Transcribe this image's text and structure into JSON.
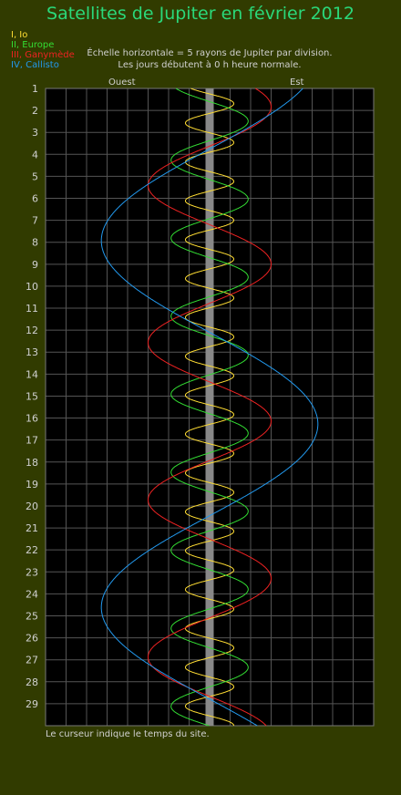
{
  "title": "Satellites de Jupiter en février 2012",
  "legend": [
    {
      "label": "I, Io",
      "color": "#ffdd33"
    },
    {
      "label": "II, Europe",
      "color": "#33dd33"
    },
    {
      "label": "III, Ganymède",
      "color": "#ee2222"
    },
    {
      "label": "IV, Callisto",
      "color": "#2299ee"
    }
  ],
  "note_line1": "Échelle horizontale = 5 rayons de Jupiter par division.",
  "note_line2": "Les jours débutent à 0 h heure normale.",
  "west_label": "Ouest",
  "east_label": "Est",
  "footer": "Le curseur indique le temps du site.",
  "chart_data": {
    "type": "line",
    "title": "Satellites de Jupiter en février 2012",
    "x_unit": "Jupiter radii (5 per division)",
    "xlim": [
      -40,
      40
    ],
    "ylim": [
      1,
      30
    ],
    "y_ticks": [
      1,
      2,
      3,
      4,
      5,
      6,
      7,
      8,
      9,
      10,
      11,
      12,
      13,
      14,
      15,
      16,
      17,
      18,
      19,
      20,
      21,
      22,
      23,
      24,
      25,
      26,
      27,
      28,
      29
    ],
    "series": [
      {
        "name": "I, Io",
        "color": "#ffdd33",
        "amplitude": 5.9,
        "period_days": 1.769,
        "phase_day": 1.25
      },
      {
        "name": "II, Europe",
        "color": "#33dd33",
        "amplitude": 9.4,
        "period_days": 3.551,
        "phase_day": 1.6
      },
      {
        "name": "III, Ganymède",
        "color": "#ee2222",
        "amplitude": 15.0,
        "period_days": 7.155,
        "phase_day": 7.2
      },
      {
        "name": "IV, Callisto",
        "color": "#2299ee",
        "amplitude": 26.4,
        "period_days": 16.69,
        "phase_day": 12.1
      }
    ]
  }
}
